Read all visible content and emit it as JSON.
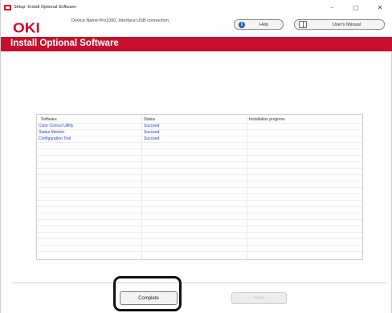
{
  "window": {
    "title": "Setup -Install Optional Software-",
    "minimize_glyph": "–",
    "maximize_glyph": "□",
    "close_glyph": "✕"
  },
  "header": {
    "logo": "OKI",
    "device_info": "Device Name:Pro1050, Interface:USB connection",
    "help_label": "Help",
    "manual_label": "User's Manual",
    "info_glyph": "i"
  },
  "banner": {
    "title": "Install Optional Software"
  },
  "table": {
    "columns": [
      "Software",
      "Status",
      "Installation progress"
    ],
    "rows": [
      {
        "software": "Color Correct Utility",
        "status": "Succeed",
        "progress": ""
      },
      {
        "software": "Status Monitor",
        "status": "Succeed",
        "progress": ""
      },
      {
        "software": "Configuration Tool",
        "status": "Succeed",
        "progress": ""
      }
    ]
  },
  "footer": {
    "complete_label": "Complete",
    "next_label": "Next"
  },
  "colors": {
    "brand_red": "#c8102e",
    "link_blue": "#2244cc"
  }
}
